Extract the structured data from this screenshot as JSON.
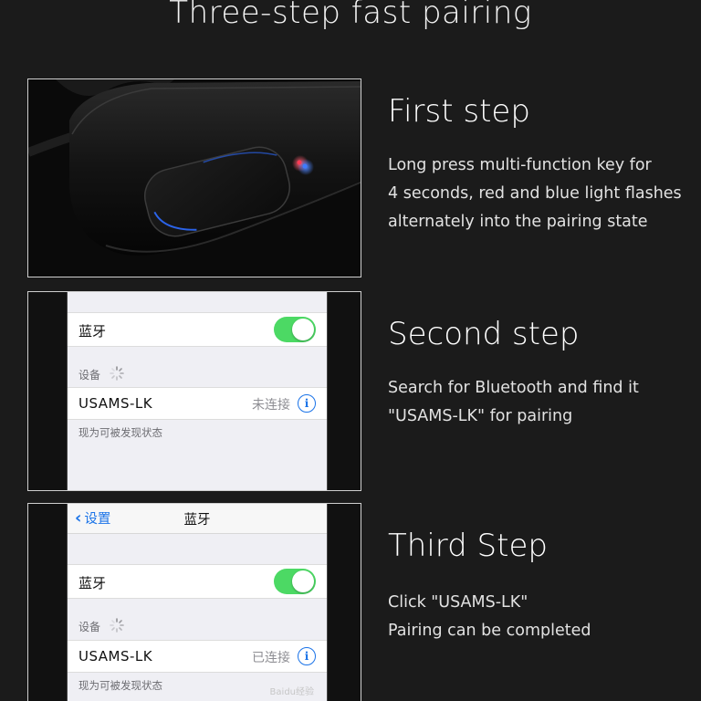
{
  "title": "Three-step fast pairing",
  "steps": [
    {
      "title": "First step",
      "desc": [
        "Long press multi-function key for",
        "4 seconds, red and blue light flashes",
        "alternately into the pairing state"
      ]
    },
    {
      "title": "Second step",
      "desc": [
        "Search for Bluetooth and find it",
        "\"USAMS-LK\" for pairing"
      ]
    },
    {
      "title": "Third Step",
      "desc": [
        "Click \"USAMS-LK\"",
        "Pairing can be completed"
      ]
    }
  ],
  "phone2": {
    "bluetooth_label": "蓝牙",
    "devices_label": "设备",
    "device_name": "USAMS-LK",
    "status": "未连接",
    "hint": "现为可被发现状态",
    "toggle_on": true
  },
  "phone3": {
    "back_label": "设置",
    "nav_title": "蓝牙",
    "bluetooth_label": "蓝牙",
    "devices_label": "设备",
    "device_name": "USAMS-LK",
    "status": "已连接",
    "hint": "现为可被发现状态",
    "watermark": "Baidu经验",
    "toggle_on": true
  },
  "icons": {
    "spinner": "loading-spinner-icon",
    "info": "info-icon",
    "back": "chevron-left-icon"
  },
  "colors": {
    "background": "#1b1b1b",
    "toggle_on": "#4cd964",
    "ios_blue": "#1a73e8",
    "led_red": "#e0304a",
    "led_blue": "#2d6bff"
  }
}
